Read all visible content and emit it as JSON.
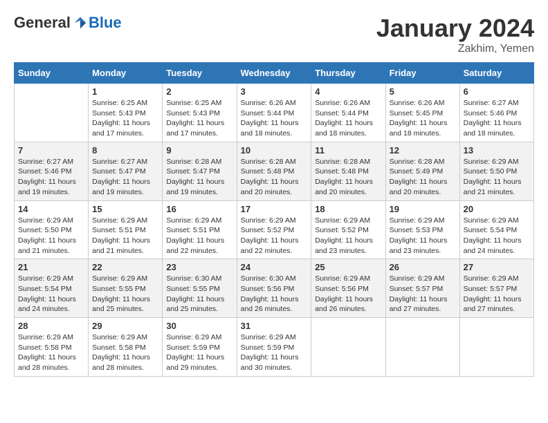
{
  "logo": {
    "general": "General",
    "blue": "Blue"
  },
  "title": "January 2024",
  "location": "Zakhim, Yemen",
  "days_of_week": [
    "Sunday",
    "Monday",
    "Tuesday",
    "Wednesday",
    "Thursday",
    "Friday",
    "Saturday"
  ],
  "weeks": [
    [
      {
        "day": "",
        "sunrise": "",
        "sunset": "",
        "daylight": ""
      },
      {
        "day": "1",
        "sunrise": "Sunrise: 6:25 AM",
        "sunset": "Sunset: 5:43 PM",
        "daylight": "Daylight: 11 hours and 17 minutes."
      },
      {
        "day": "2",
        "sunrise": "Sunrise: 6:25 AM",
        "sunset": "Sunset: 5:43 PM",
        "daylight": "Daylight: 11 hours and 17 minutes."
      },
      {
        "day": "3",
        "sunrise": "Sunrise: 6:26 AM",
        "sunset": "Sunset: 5:44 PM",
        "daylight": "Daylight: 11 hours and 18 minutes."
      },
      {
        "day": "4",
        "sunrise": "Sunrise: 6:26 AM",
        "sunset": "Sunset: 5:44 PM",
        "daylight": "Daylight: 11 hours and 18 minutes."
      },
      {
        "day": "5",
        "sunrise": "Sunrise: 6:26 AM",
        "sunset": "Sunset: 5:45 PM",
        "daylight": "Daylight: 11 hours and 18 minutes."
      },
      {
        "day": "6",
        "sunrise": "Sunrise: 6:27 AM",
        "sunset": "Sunset: 5:46 PM",
        "daylight": "Daylight: 11 hours and 18 minutes."
      }
    ],
    [
      {
        "day": "7",
        "sunrise": "Sunrise: 6:27 AM",
        "sunset": "Sunset: 5:46 PM",
        "daylight": "Daylight: 11 hours and 19 minutes."
      },
      {
        "day": "8",
        "sunrise": "Sunrise: 6:27 AM",
        "sunset": "Sunset: 5:47 PM",
        "daylight": "Daylight: 11 hours and 19 minutes."
      },
      {
        "day": "9",
        "sunrise": "Sunrise: 6:28 AM",
        "sunset": "Sunset: 5:47 PM",
        "daylight": "Daylight: 11 hours and 19 minutes."
      },
      {
        "day": "10",
        "sunrise": "Sunrise: 6:28 AM",
        "sunset": "Sunset: 5:48 PM",
        "daylight": "Daylight: 11 hours and 20 minutes."
      },
      {
        "day": "11",
        "sunrise": "Sunrise: 6:28 AM",
        "sunset": "Sunset: 5:48 PM",
        "daylight": "Daylight: 11 hours and 20 minutes."
      },
      {
        "day": "12",
        "sunrise": "Sunrise: 6:28 AM",
        "sunset": "Sunset: 5:49 PM",
        "daylight": "Daylight: 11 hours and 20 minutes."
      },
      {
        "day": "13",
        "sunrise": "Sunrise: 6:29 AM",
        "sunset": "Sunset: 5:50 PM",
        "daylight": "Daylight: 11 hours and 21 minutes."
      }
    ],
    [
      {
        "day": "14",
        "sunrise": "Sunrise: 6:29 AM",
        "sunset": "Sunset: 5:50 PM",
        "daylight": "Daylight: 11 hours and 21 minutes."
      },
      {
        "day": "15",
        "sunrise": "Sunrise: 6:29 AM",
        "sunset": "Sunset: 5:51 PM",
        "daylight": "Daylight: 11 hours and 21 minutes."
      },
      {
        "day": "16",
        "sunrise": "Sunrise: 6:29 AM",
        "sunset": "Sunset: 5:51 PM",
        "daylight": "Daylight: 11 hours and 22 minutes."
      },
      {
        "day": "17",
        "sunrise": "Sunrise: 6:29 AM",
        "sunset": "Sunset: 5:52 PM",
        "daylight": "Daylight: 11 hours and 22 minutes."
      },
      {
        "day": "18",
        "sunrise": "Sunrise: 6:29 AM",
        "sunset": "Sunset: 5:52 PM",
        "daylight": "Daylight: 11 hours and 23 minutes."
      },
      {
        "day": "19",
        "sunrise": "Sunrise: 6:29 AM",
        "sunset": "Sunset: 5:53 PM",
        "daylight": "Daylight: 11 hours and 23 minutes."
      },
      {
        "day": "20",
        "sunrise": "Sunrise: 6:29 AM",
        "sunset": "Sunset: 5:54 PM",
        "daylight": "Daylight: 11 hours and 24 minutes."
      }
    ],
    [
      {
        "day": "21",
        "sunrise": "Sunrise: 6:29 AM",
        "sunset": "Sunset: 5:54 PM",
        "daylight": "Daylight: 11 hours and 24 minutes."
      },
      {
        "day": "22",
        "sunrise": "Sunrise: 6:29 AM",
        "sunset": "Sunset: 5:55 PM",
        "daylight": "Daylight: 11 hours and 25 minutes."
      },
      {
        "day": "23",
        "sunrise": "Sunrise: 6:30 AM",
        "sunset": "Sunset: 5:55 PM",
        "daylight": "Daylight: 11 hours and 25 minutes."
      },
      {
        "day": "24",
        "sunrise": "Sunrise: 6:30 AM",
        "sunset": "Sunset: 5:56 PM",
        "daylight": "Daylight: 11 hours and 26 minutes."
      },
      {
        "day": "25",
        "sunrise": "Sunrise: 6:29 AM",
        "sunset": "Sunset: 5:56 PM",
        "daylight": "Daylight: 11 hours and 26 minutes."
      },
      {
        "day": "26",
        "sunrise": "Sunrise: 6:29 AM",
        "sunset": "Sunset: 5:57 PM",
        "daylight": "Daylight: 11 hours and 27 minutes."
      },
      {
        "day": "27",
        "sunrise": "Sunrise: 6:29 AM",
        "sunset": "Sunset: 5:57 PM",
        "daylight": "Daylight: 11 hours and 27 minutes."
      }
    ],
    [
      {
        "day": "28",
        "sunrise": "Sunrise: 6:29 AM",
        "sunset": "Sunset: 5:58 PM",
        "daylight": "Daylight: 11 hours and 28 minutes."
      },
      {
        "day": "29",
        "sunrise": "Sunrise: 6:29 AM",
        "sunset": "Sunset: 5:58 PM",
        "daylight": "Daylight: 11 hours and 28 minutes."
      },
      {
        "day": "30",
        "sunrise": "Sunrise: 6:29 AM",
        "sunset": "Sunset: 5:59 PM",
        "daylight": "Daylight: 11 hours and 29 minutes."
      },
      {
        "day": "31",
        "sunrise": "Sunrise: 6:29 AM",
        "sunset": "Sunset: 5:59 PM",
        "daylight": "Daylight: 11 hours and 30 minutes."
      },
      {
        "day": "",
        "sunrise": "",
        "sunset": "",
        "daylight": ""
      },
      {
        "day": "",
        "sunrise": "",
        "sunset": "",
        "daylight": ""
      },
      {
        "day": "",
        "sunrise": "",
        "sunset": "",
        "daylight": ""
      }
    ]
  ]
}
